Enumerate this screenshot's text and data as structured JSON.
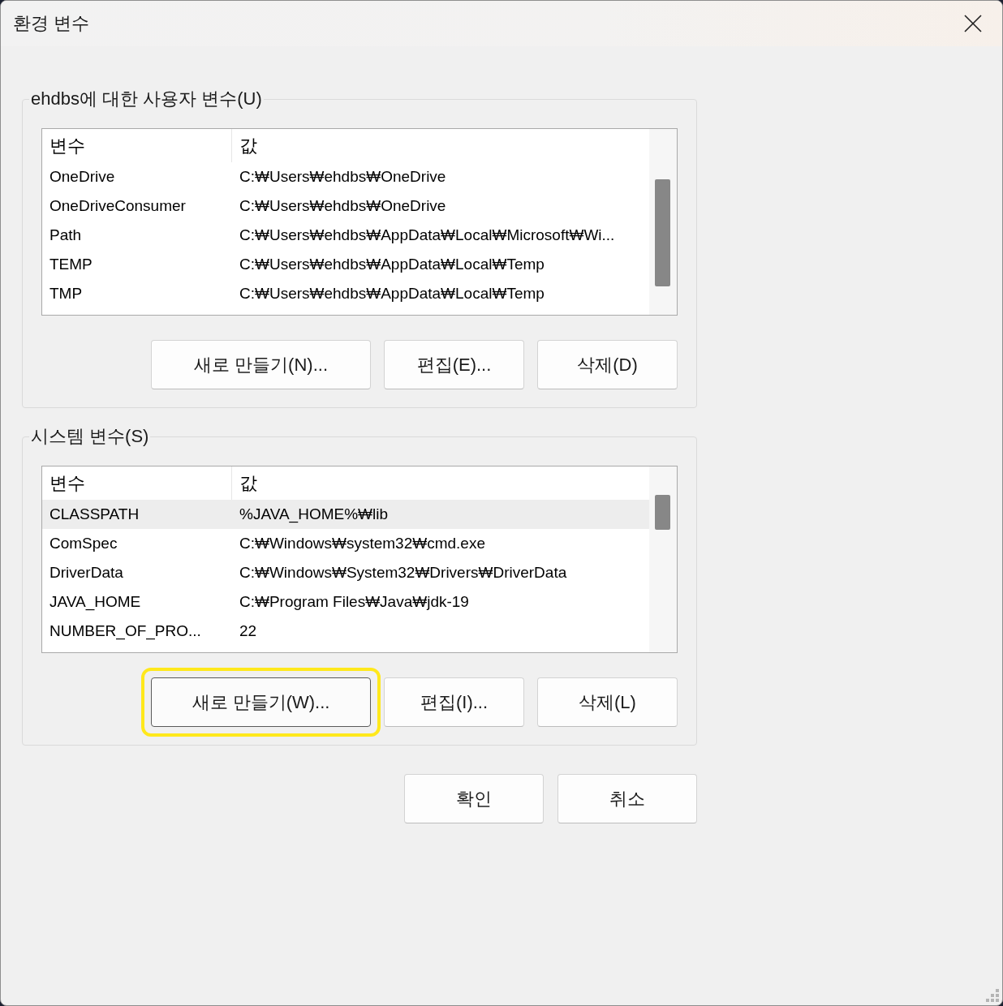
{
  "window": {
    "title": "환경 변수"
  },
  "user_variables": {
    "label": "ehdbs에 대한 사용자 변수(U)",
    "columns": [
      "변수",
      "값"
    ],
    "rows": [
      {
        "name": "OneDrive",
        "value": "C:₩Users₩ehdbs₩OneDrive",
        "selected": false
      },
      {
        "name": "OneDriveConsumer",
        "value": "C:₩Users₩ehdbs₩OneDrive",
        "selected": false
      },
      {
        "name": "Path",
        "value": "C:₩Users₩ehdbs₩AppData₩Local₩Microsoft₩Wi...",
        "selected": false
      },
      {
        "name": "TEMP",
        "value": "C:₩Users₩ehdbs₩AppData₩Local₩Temp",
        "selected": false
      },
      {
        "name": "TMP",
        "value": "C:₩Users₩ehdbs₩AppData₩Local₩Temp",
        "selected": false
      }
    ],
    "buttons": [
      {
        "label": "새로 만들기(N)...",
        "focused": false
      },
      {
        "label": "편집(E)...",
        "focused": false
      },
      {
        "label": "삭제(D)",
        "focused": false
      }
    ]
  },
  "system_variables": {
    "label": "시스템 변수(S)",
    "columns": [
      "변수",
      "값"
    ],
    "rows": [
      {
        "name": "CLASSPATH",
        "value": "%JAVA_HOME%₩lib",
        "selected": true
      },
      {
        "name": "ComSpec",
        "value": "C:₩Windows₩system32₩cmd.exe",
        "selected": false
      },
      {
        "name": "DriverData",
        "value": "C:₩Windows₩System32₩Drivers₩DriverData",
        "selected": false
      },
      {
        "name": "JAVA_HOME",
        "value": "C:₩Program Files₩Java₩jdk-19",
        "selected": false
      },
      {
        "name": "NUMBER_OF_PRO...",
        "value": "22",
        "selected": false
      }
    ],
    "buttons": [
      {
        "label": "새로 만들기(W)...",
        "focused": true
      },
      {
        "label": "편집(I)...",
        "focused": false
      },
      {
        "label": "삭제(L)",
        "focused": false
      }
    ]
  },
  "buttons": [
    {
      "label": "확인",
      "focused": false
    },
    {
      "label": "취소",
      "focused": false
    }
  ]
}
